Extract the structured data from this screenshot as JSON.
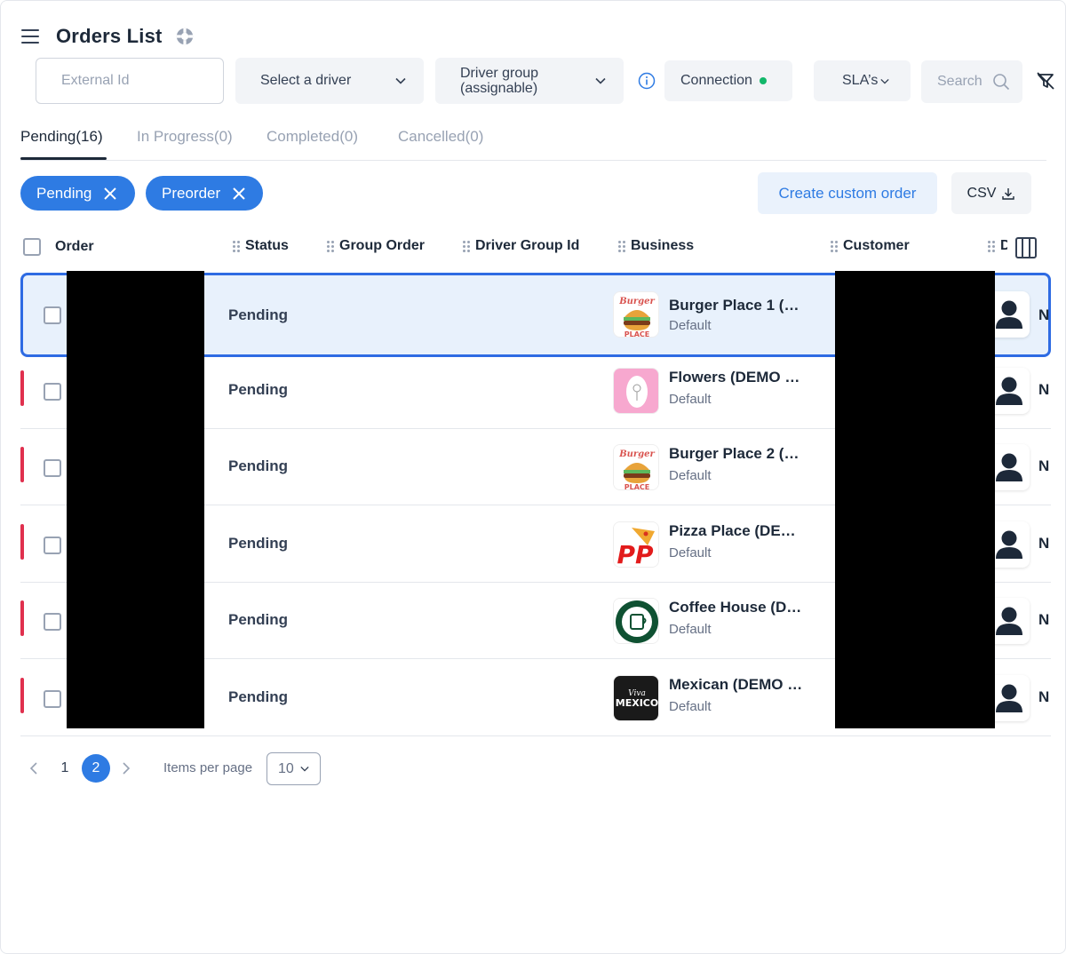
{
  "header": {
    "title": "Orders List",
    "menu_icon": "hamburger-icon",
    "help_icon": "lifebuoy-icon"
  },
  "filters": {
    "external_id_placeholder": "External Id",
    "driver_select": "Select a driver",
    "driver_group": "Driver group (assignable)",
    "connection": "Connection",
    "connection_status_color": "#12b76a",
    "sla": "SLA’s",
    "search_placeholder": "Search"
  },
  "tabs": [
    {
      "label": "Pending(16)",
      "active": true
    },
    {
      "label": "In Progress(0)"
    },
    {
      "label": "Completed(0)"
    },
    {
      "label": "Cancelled(0)"
    }
  ],
  "chips": [
    {
      "label": "Pending"
    },
    {
      "label": "Preorder"
    }
  ],
  "actions": {
    "create": "Create custom order",
    "csv": "CSV"
  },
  "columns": {
    "order": "Order",
    "status": "Status",
    "group_order": "Group Order",
    "driver_group_id": "Driver Group Id",
    "business": "Business",
    "customer": "Customer",
    "trailing": "D"
  },
  "rows": [
    {
      "status": "Pending",
      "business": "Burger Place 1 (…",
      "business_sub": "Default",
      "logo": "burger",
      "trail": "N"
    },
    {
      "status": "Pending",
      "business": "Flowers (DEMO …",
      "business_sub": "Default",
      "logo": "flowers",
      "trail": "N"
    },
    {
      "status": "Pending",
      "business": "Burger Place 2 (…",
      "business_sub": "Default",
      "logo": "burger",
      "trail": "N"
    },
    {
      "status": "Pending",
      "business": "Pizza Place (DE…",
      "business_sub": "Default",
      "logo": "pizza",
      "trail": "N"
    },
    {
      "status": "Pending",
      "business": "Coffee House (D…",
      "business_sub": "Default",
      "logo": "coffee",
      "trail": "N"
    },
    {
      "status": "Pending",
      "business": "Mexican (DEMO …",
      "business_sub": "Default",
      "logo": "mexican",
      "trail": "N"
    }
  ],
  "pagination": {
    "pages": [
      "1",
      "2"
    ],
    "current": "2",
    "items_per_page_label": "Items per page",
    "items_per_page": "10"
  },
  "colors": {
    "accent": "#2e7be3",
    "flag": "#e0304e"
  }
}
